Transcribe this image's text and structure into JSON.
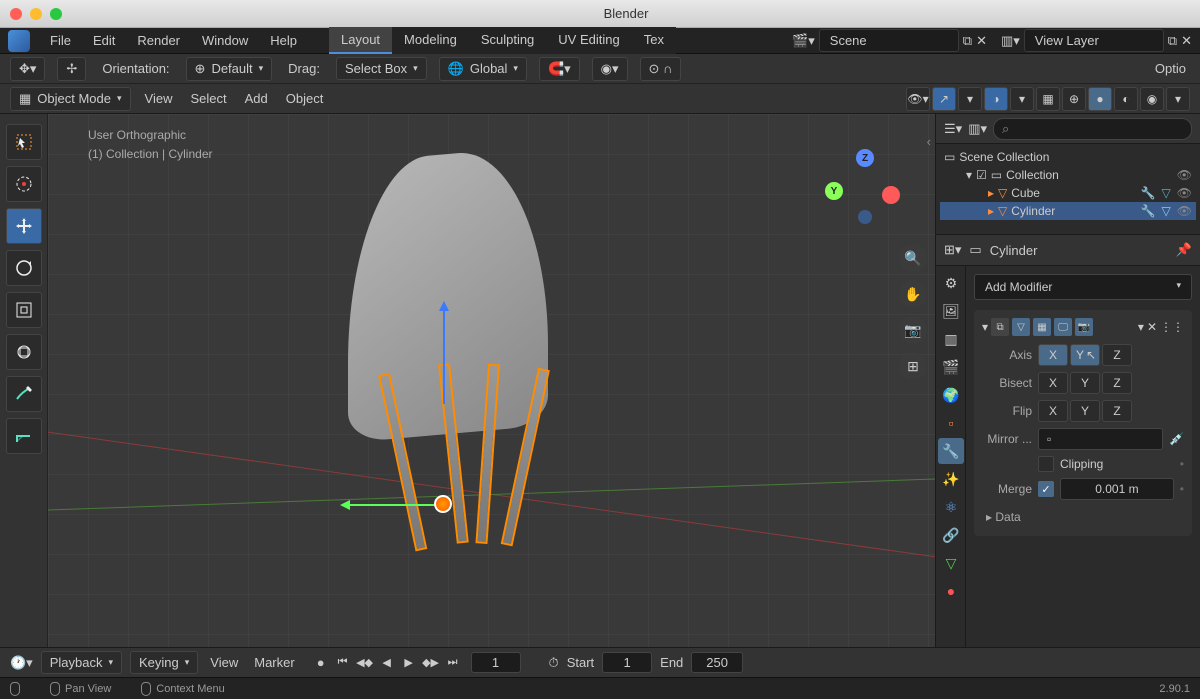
{
  "title": "Blender",
  "menus": [
    "File",
    "Edit",
    "Render",
    "Window",
    "Help"
  ],
  "workspaces": [
    "Layout",
    "Modeling",
    "Sculpting",
    "UV Editing",
    "Tex"
  ],
  "active_workspace": "Layout",
  "scene": {
    "name": "Scene",
    "layer": "View Layer"
  },
  "toolbar": {
    "orientation_label": "Orientation:",
    "orientation": "Default",
    "drag_label": "Drag:",
    "drag": "Select Box",
    "transform": "Global",
    "options": "Optio"
  },
  "header2": {
    "mode": "Object Mode",
    "menus": [
      "View",
      "Select",
      "Add",
      "Object"
    ]
  },
  "viewport": {
    "line1": "User Orthographic",
    "line2": "(1) Collection | Cylinder"
  },
  "outliner": {
    "root": "Scene Collection",
    "collection": "Collection",
    "items": [
      "Cube",
      "Cylinder"
    ]
  },
  "properties": {
    "object_name": "Cylinder",
    "add_modifier": "Add Modifier",
    "axis_label": "Axis",
    "bisect_label": "Bisect",
    "flip_label": "Flip",
    "mirror_label": "Mirror ...",
    "clipping_label": "Clipping",
    "merge_label": "Merge",
    "merge_value": "0.001 m",
    "data_label": "Data",
    "axes": [
      "X",
      "Y",
      "Z"
    ]
  },
  "timeline": {
    "playback": "Playback",
    "keying": "Keying",
    "view": "View",
    "marker": "Marker",
    "current": "1",
    "start_label": "Start",
    "start": "1",
    "end_label": "End",
    "end": "250"
  },
  "statusbar": {
    "pan": "Pan View",
    "context": "Context Menu",
    "version": "2.90.1"
  }
}
